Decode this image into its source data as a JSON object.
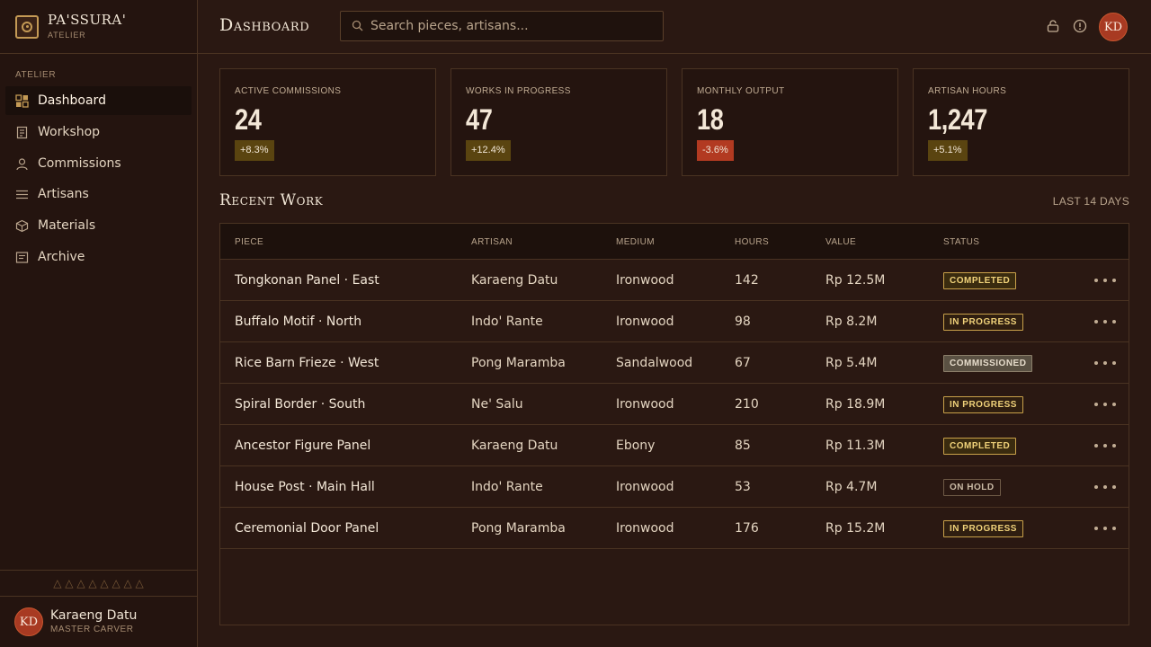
{
  "brand": {
    "name": "PA'SSURA'",
    "sub": "ATELIER"
  },
  "sidebar": {
    "section_label": "ATELIER",
    "items": [
      {
        "label": "Dashboard",
        "icon": "grid-icon",
        "active": true
      },
      {
        "label": "Workshop",
        "icon": "clipboard-icon"
      },
      {
        "label": "Commissions",
        "icon": "user-icon"
      },
      {
        "label": "Artisans",
        "icon": "list-icon"
      },
      {
        "label": "Materials",
        "icon": "box-icon"
      },
      {
        "label": "Archive",
        "icon": "archive-icon"
      }
    ],
    "ornament": "△ △ △ △ △ △ △ △",
    "user": {
      "initials": "KD",
      "name": "Karaeng Datu",
      "role": "MASTER CARVER"
    }
  },
  "header": {
    "title": "Dashboard",
    "search_placeholder": "Search pieces, artisans...",
    "avatar_initials": "KD",
    "icons": [
      "lock-icon",
      "alert-icon"
    ]
  },
  "stats": [
    {
      "label": "ACTIVE COMMISSIONS",
      "value": "24",
      "delta": "+8.3%",
      "trend": "up"
    },
    {
      "label": "WORKS IN PROGRESS",
      "value": "47",
      "delta": "+12.4%",
      "trend": "up"
    },
    {
      "label": "MONTHLY OUTPUT",
      "value": "18",
      "delta": "-3.6%",
      "trend": "down"
    },
    {
      "label": "ARTISAN HOURS",
      "value": "1,247",
      "delta": "+5.1%",
      "trend": "up"
    }
  ],
  "recent": {
    "title": "Recent Work",
    "range": "LAST 14 DAYS",
    "columns": [
      "PIECE",
      "ARTISAN",
      "MEDIUM",
      "HOURS",
      "VALUE",
      "STATUS"
    ],
    "rows": [
      {
        "piece": "Tongkonan Panel · East",
        "artisan": "Karaeng Datu",
        "medium": "Ironwood",
        "hours": "142",
        "value": "Rp 12.5M",
        "status": "COMPLETED"
      },
      {
        "piece": "Buffalo Motif · North",
        "artisan": "Indo' Rante",
        "medium": "Ironwood",
        "hours": "98",
        "value": "Rp 8.2M",
        "status": "IN PROGRESS"
      },
      {
        "piece": "Rice Barn Frieze · West",
        "artisan": "Pong Maramba",
        "medium": "Sandalwood",
        "hours": "67",
        "value": "Rp 5.4M",
        "status": "COMMISSIONED"
      },
      {
        "piece": "Spiral Border · South",
        "artisan": "Ne' Salu",
        "medium": "Ironwood",
        "hours": "210",
        "value": "Rp 18.9M",
        "status": "IN PROGRESS"
      },
      {
        "piece": "Ancestor Figure Panel",
        "artisan": "Karaeng Datu",
        "medium": "Ebony",
        "hours": "85",
        "value": "Rp 11.3M",
        "status": "COMPLETED"
      },
      {
        "piece": "House Post · Main Hall",
        "artisan": "Indo' Rante",
        "medium": "Ironwood",
        "hours": "53",
        "value": "Rp 4.7M",
        "status": "ON HOLD"
      },
      {
        "piece": "Ceremonial Door Panel",
        "artisan": "Pong Maramba",
        "medium": "Ironwood",
        "hours": "176",
        "value": "Rp 15.2M",
        "status": "IN PROGRESS"
      }
    ]
  },
  "colors": {
    "background": "#2a1812",
    "sidebar": "#24140f",
    "accent_gold": "#c49a55",
    "negative": "#b23a21",
    "avatar": "#a83a22"
  }
}
